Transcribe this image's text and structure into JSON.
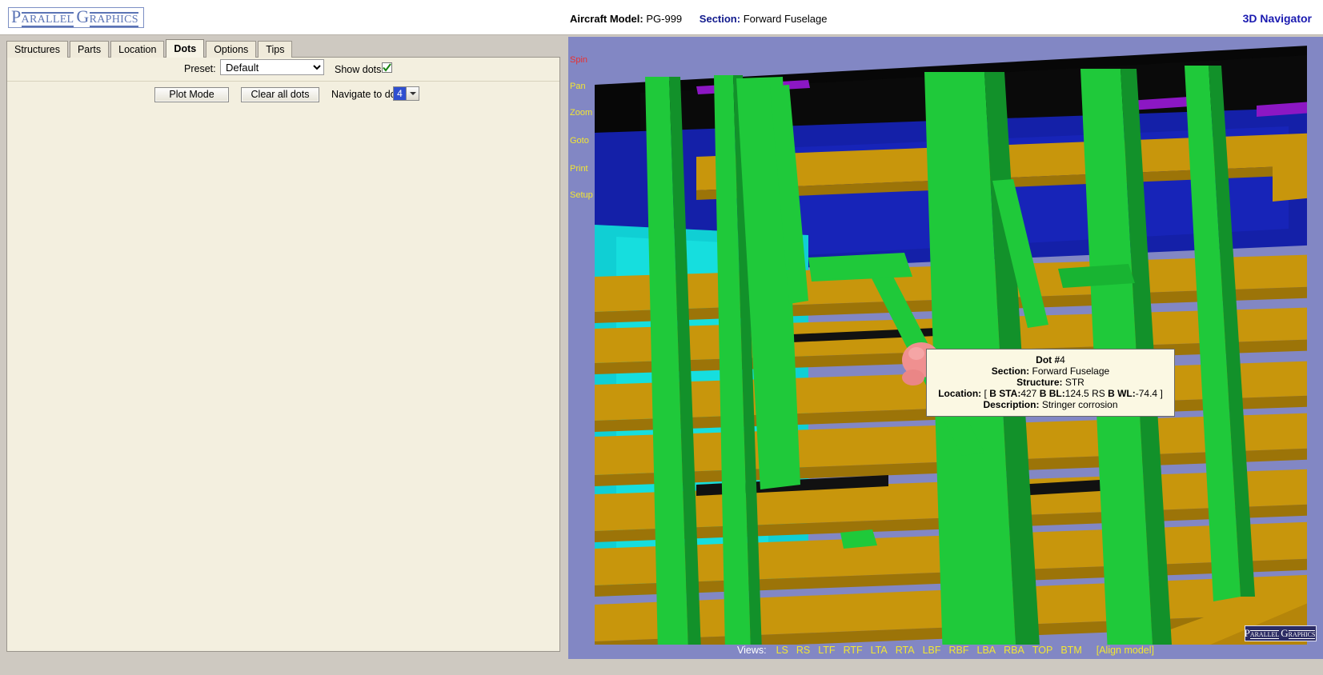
{
  "brand": {
    "logo_cap1": "P",
    "logo_word1": "ARALLEL",
    "logo_cap2": "G",
    "logo_word2": "RAPHICS"
  },
  "header": {
    "aircraft_model_label": "Aircraft Model:",
    "aircraft_model_value": "PG-999",
    "section_label": "Section:",
    "section_value": "Forward Fuselage",
    "app_title": "3D Navigator"
  },
  "tabs": [
    {
      "label": "Structures",
      "active": false
    },
    {
      "label": "Parts",
      "active": false
    },
    {
      "label": "Location",
      "active": false
    },
    {
      "label": "Dots",
      "active": true
    },
    {
      "label": "Options",
      "active": false
    },
    {
      "label": "Tips",
      "active": false
    }
  ],
  "controls": {
    "preset_label": "Preset:",
    "preset_value": "Default",
    "preset_options": [
      "Default"
    ],
    "show_dots_label": "Show dots:",
    "show_dots_checked": true,
    "plot_mode_label": "Plot Mode",
    "clear_all_dots_label": "Clear all dots",
    "navigate_to_dot_label": "Navigate to dot",
    "navigate_to_dot_value": "4"
  },
  "viewport_nav": [
    {
      "label": "Spin",
      "selected": true
    },
    {
      "label": "Pan",
      "selected": false
    },
    {
      "label": "Zoom",
      "selected": false
    },
    {
      "label": "Goto",
      "selected": false
    },
    {
      "label": "Print",
      "selected": false
    },
    {
      "label": "Setup",
      "selected": false
    }
  ],
  "tooltip": {
    "title_label": "Dot #",
    "title_number": "4",
    "section_label": "Section:",
    "section_value": "Forward Fuselage",
    "structure_label": "Structure:",
    "structure_value": "STR",
    "location_label": "Location:",
    "location_open": "[",
    "bsta_label": "B STA:",
    "bsta_value": "427",
    "bbl_label": "B BL:",
    "bbl_value": "124.5 RS",
    "bwl_label": "B WL:",
    "bwl_value": "-74.4",
    "location_close": "]",
    "description_label": "Description:",
    "description_value": "Stringer corrosion"
  },
  "views": {
    "label": "Views:",
    "buttons": [
      "LS",
      "RS",
      "LTF",
      "RTF",
      "LTA",
      "RTA",
      "LBF",
      "RBF",
      "LBA",
      "RBA",
      "TOP",
      "BTM"
    ],
    "align_label": "[Align model]"
  },
  "watermark": {
    "cap1": "P",
    "word1": "ARALLEL",
    "cap2": "G",
    "word2": "RAPHICS"
  },
  "colors": {
    "viewport_bg": "#8287c4",
    "beam_gold": "#c8960c",
    "beam_gold_dark": "#9c7408",
    "strut_green": "#1fc93a",
    "strut_green_dark": "#12912a",
    "panel_blue": "#1420a8",
    "panel_cyan": "#10cfd4",
    "panel_black": "#070707",
    "accent_purple": "#8c17c4",
    "dot_pink": "#f09090",
    "nav_yellow": "#f2e632",
    "nav_selected_red": "#e83030"
  }
}
